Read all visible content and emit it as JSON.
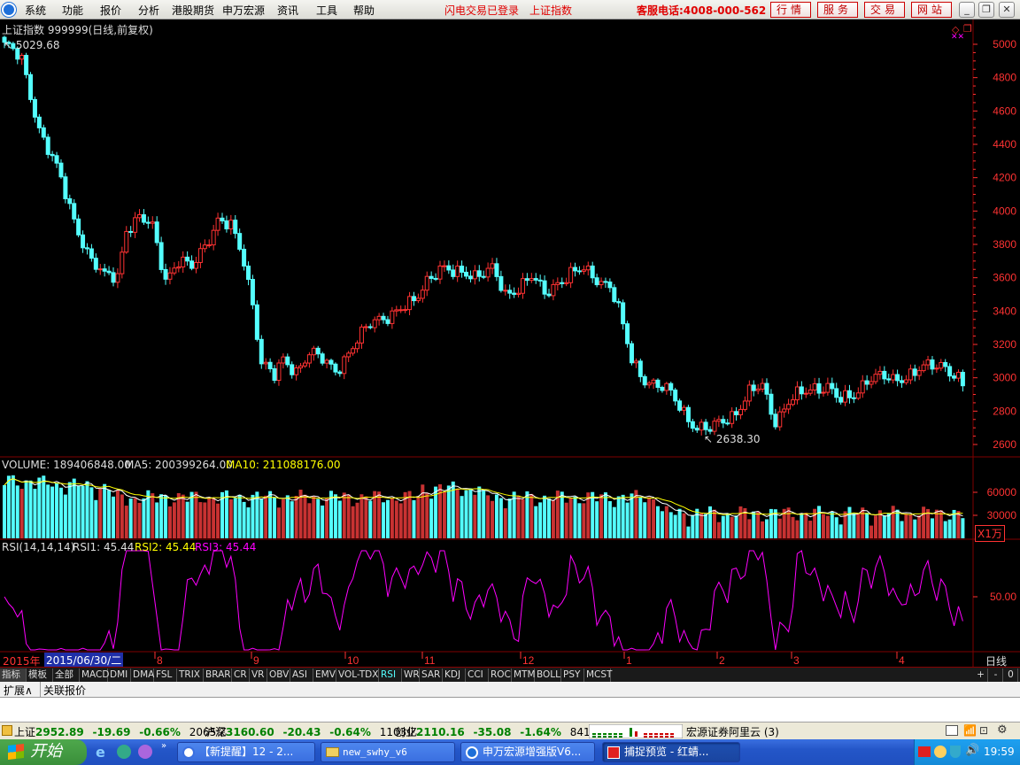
{
  "menu": {
    "items": [
      "系统",
      "功能",
      "报价",
      "分析",
      "港股期货",
      "申万宏源",
      "资讯",
      "工具",
      "帮助"
    ],
    "status_login": "闪电交易已登录",
    "index_name": "上证指数",
    "hotline": "客服电话:4008-000-562",
    "tabs": [
      "行情",
      "服务",
      "交易",
      "网站"
    ]
  },
  "chart_header": {
    "title": "上证指数 999999(日线,前复权)"
  },
  "price_chart": {
    "high_label": "5029.68",
    "low_label": "2638.30",
    "y_ticks": [
      "5000",
      "4800",
      "4600",
      "4400",
      "4200",
      "4000",
      "3800",
      "3600",
      "3400",
      "3200",
      "3000",
      "2800",
      "2600"
    ]
  },
  "volume_panel": {
    "volume_label": "VOLUME: 189406848.00",
    "ma5_label": "MA5: 200399264.00",
    "ma10_label": "MA10: 211088176.00",
    "y_ticks": [
      "60000",
      "30000"
    ],
    "unit_label": "X1万"
  },
  "rsi_panel": {
    "title_label": "RSI(14,14,14)",
    "rsi1_label": "RSI1: 45.44",
    "rsi2_label": "RSI2: 45.44",
    "rsi3_label": "RSI3: 45.44",
    "y_tick": "50.00"
  },
  "time_axis": {
    "year": "2015年",
    "cursor_date": "2015/06/30/二",
    "months": [
      "8",
      "9",
      "10",
      "11",
      "12",
      "1",
      "2",
      "3",
      "4"
    ],
    "period": "日线"
  },
  "indicator_bar": {
    "tabs": [
      "指标",
      "模板",
      "全部"
    ],
    "indicators": [
      "MACD",
      "DMI",
      "DMA",
      "FSL",
      "TRIX",
      "BRAR",
      "CR",
      "VR",
      "OBV",
      "ASI",
      "EMV",
      "VOL-TDX",
      "RSI",
      "WR",
      "SAR",
      "KDJ",
      "CCI",
      "ROC",
      "MTM",
      "BOLL",
      "PSY",
      "MCST"
    ],
    "active": "RSI",
    "controls": [
      "+",
      "-",
      "0"
    ]
  },
  "ext_bar": {
    "tabs": [
      "扩展∧",
      "关联报价"
    ]
  },
  "status": {
    "sh_name": "上证",
    "sh_value": "2952.89",
    "sh_change": "-19.69",
    "sh_pct": "-0.66%",
    "sh_amount": "2065亿",
    "hs_name": "沪深",
    "hs_value": "3160.60",
    "hs_change": "-20.43",
    "hs_pct": "-0.64%",
    "hs_amount": "1103亿",
    "cy_name": "创业",
    "cy_value": "2110.16",
    "cy_change": "-35.08",
    "cy_pct": "-1.64%",
    "cy_amount": "841.9亿",
    "broker": "宏源证券阿里云 (3)"
  },
  "taskbar": {
    "start": "开始",
    "tasks": [
      "【新提醒】12 - 2...",
      "new_swhy_v6",
      "申万宏源增强版V6...",
      "捕捉预览 - 红蜻..."
    ],
    "clock": "19:59"
  },
  "colors": {
    "up": "#ff3232",
    "down": "#54ffff",
    "ma5": "#ffffff",
    "ma10": "#ffff00",
    "rsi": "#ff00ff",
    "grid": "#800000"
  }
}
